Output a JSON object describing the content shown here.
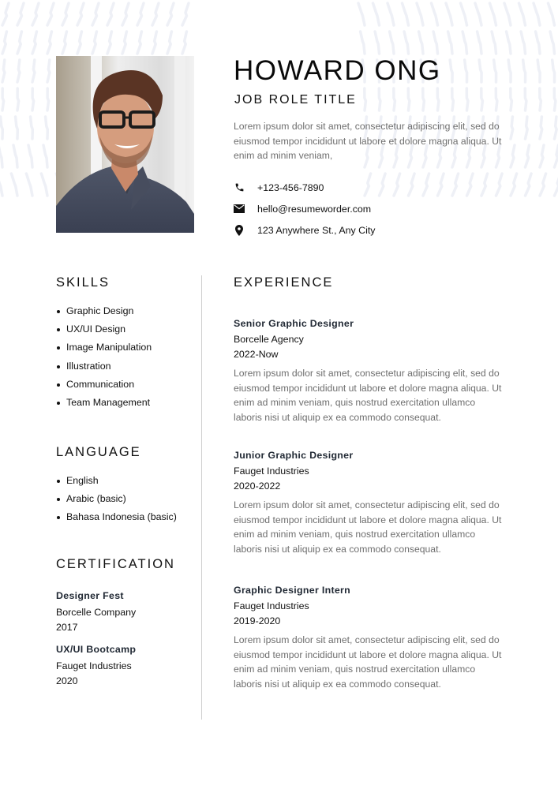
{
  "header": {
    "name": "HOWARD ONG",
    "role": "JOB ROLE TITLE",
    "summary": "Lorem ipsum dolor sit amet, consectetur adipiscing elit, sed do eiusmod tempor incididunt ut labore et dolore magna aliqua. Ut enim ad minim veniam,"
  },
  "contact": [
    {
      "icon": "phone-icon",
      "value": "+123-456-7890"
    },
    {
      "icon": "mail-icon",
      "value": "hello@resumeworder.com"
    },
    {
      "icon": "location-pin-icon",
      "value": "123 Anywhere St., Any City"
    }
  ],
  "skills": {
    "heading": "SKILLS",
    "items": [
      "Graphic Design",
      "UX/UI Design",
      "Image Manipulation",
      "Illustration",
      "Communication",
      "Team Management"
    ]
  },
  "language": {
    "heading": "LANGUAGE",
    "items": [
      "English",
      "Arabic (basic)",
      "Bahasa Indonesia (basic)"
    ]
  },
  "certification": {
    "heading": "CERTIFICATION",
    "items": [
      {
        "title": "Designer Fest",
        "org": "Borcelle Company",
        "year": "2017"
      },
      {
        "title": "UX/UI Bootcamp",
        "org": "Fauget Industries",
        "year": "2020"
      }
    ]
  },
  "experience": {
    "heading": "EXPERIENCE",
    "items": [
      {
        "title": "Senior Graphic Designer",
        "org": "Borcelle Agency",
        "period": "2022-Now",
        "description": "Lorem ipsum dolor sit amet, consectetur adipiscing elit, sed do eiusmod tempor incididunt ut labore et dolore magna aliqua. Ut enim ad minim veniam, quis nostrud exercitation ullamco laboris nisi ut aliquip ex ea commodo consequat."
      },
      {
        "title": "Junior Graphic Designer",
        "org": "Fauget Industries",
        "period": "2020-2022",
        "description": "Lorem ipsum dolor sit amet, consectetur adipiscing elit, sed do eiusmod tempor incididunt ut labore et dolore magna aliqua. Ut enim ad minim veniam, quis nostrud exercitation ullamco laboris nisi ut aliquip ex ea commodo consequat."
      },
      {
        "title": "Graphic Designer Intern",
        "org": "Fauget Industries",
        "period": "2019-2020",
        "description": "Lorem ipsum dolor sit amet, consectetur adipiscing elit, sed do eiusmod tempor incididunt ut labore et dolore magna aliqua. Ut enim ad minim veniam, quis nostrud exercitation ullamco laboris nisi ut aliquip ex ea commodo consequat."
      }
    ]
  },
  "photo": {
    "alt": "Portrait of Howard Ong"
  },
  "colors": {
    "heading_text": "#111111",
    "body_gray": "#6e6e6e",
    "bold_title": "#222a35",
    "divider": "#cfcfcf",
    "pattern": "#eef0f6"
  }
}
